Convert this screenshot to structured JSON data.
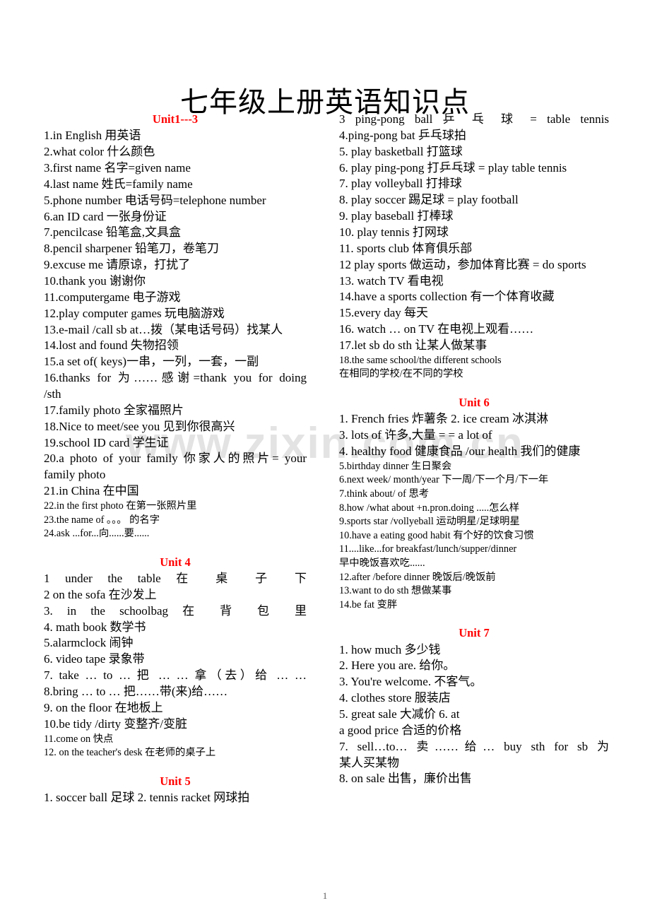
{
  "document": {
    "title": "七年级上册英语知识点",
    "page_number": "1",
    "watermark": "www.zixin.com.cn",
    "heading_color": "#ff0000"
  },
  "left_column": {
    "unit1_heading": "Unit1---3",
    "unit1_items": [
      "1.in English 用英语",
      "2.what color 什么颜色",
      "3.first name 名字=given name",
      "4.last name 姓氏=family name",
      "5.phone number 电话号码=telephone number",
      "6.an ID card 一张身份证",
      "7.pencilcase 铅笔盒,文具盒",
      "8.pencil sharpener 铅笔刀，卷笔刀",
      "9.excuse me 请原谅，打扰了",
      "10.thank you 谢谢你",
      "11.computergame 电子游戏",
      "12.play computer games 玩电脑游戏",
      "13.e-mail /call sb at…拨（某电话号码）找某人",
      "14.lost and found 失物招领",
      "15.a set of( keys)一串，一列，一套，一副",
      "16.thanks for 为……感谢=thank you for doing",
      "/sth",
      "17.family photo 全家福照片",
      "18.Nice to meet/see you 见到你很高兴",
      "19.school ID card 学生证",
      "20.a photo of your family 你家人的照片= your",
      "family photo",
      "21.in China  在中国"
    ],
    "unit1_items_small": [
      "22.in the first photo  在第一张照片里",
      "23.the name of  。。。 的名字",
      "24.ask ...for...向......要......"
    ],
    "unit4_heading": "Unit 4",
    "unit4_items": [
      "1  under   the   table        在   桌   子   下",
      "2  on the sofa    在沙发上",
      "3.   in    the    schoolbag    在   背   包   里",
      "4.  math book    数学书",
      "5.alarmclock  闹钟",
      "6. video tape    录象带",
      "7.  take  …   to  …   把 … … 拿（去）给 … …",
      "8.bring  …  to  …  把……带(来)给……",
      "9.  on the floor 在地板上",
      "10.be tidy /dirty  变整齐/变脏"
    ],
    "unit4_items_small": [
      "11.come on  快点",
      "12. on the teacher's desk  在老师的桌子上"
    ],
    "unit5_heading": "Unit 5",
    "unit5_items": [
      "1. soccer ball  足球    2. tennis racket    网球拍"
    ]
  },
  "right_column": {
    "unit5_cont_items": [
      "3   ping-pong  ball   乒 乓 球    =  table  tennis",
      "4.ping-pong bat  乒乓球拍",
      "5. play basketball    打篮球",
      "6. play ping-pong  打乒乓球  = play table tennis",
      "7. play volleyball    打排球",
      "8. play soccer    踢足球 = play football",
      "9.  play baseball    打棒球",
      "10. play tennis    打网球",
      "11.  sports club  体育俱乐部",
      "12 play sports 做运动，参加体育比赛  = do sports",
      "13.  watch TV   看电视",
      "14.have a  sports collection  有一个体育收藏",
      "15.every day     每天",
      "16.  watch  …  on TV    在电视上观看……",
      "17.let sb do sth  让某人做某事"
    ],
    "unit5_cont_items_small": [
      "18.the same school/the different schools",
      "在相同的学校/在不同的学校"
    ],
    "unit6_heading": "Unit 6",
    "unit6_items": [
      "1. French fries    炸薯条 2.   ice cream  冰淇淋",
      "3. lots of  许多,大量    = = a lot of",
      "4. healthy food 健康食品    /our health 我们的健康"
    ],
    "unit6_items_small": [
      "5.birthday dinner  生日聚会",
      "6.next week/ month/year 下一周/下一个月/下一年",
      "7.think about/ of  思考",
      "8.how /what about +n.pron.doing .....怎么样",
      "9.sports star /vollyeball   运动明星/足球明星",
      "10.have a eating good habit  有个好的饮食习惯",
      "11....like...for breakfast/lunch/supper/dinner",
      "早中晚饭喜欢吃......",
      "12.after /before dinner  晚饭后/晚饭前",
      "13.want to do sth   想做某事",
      "14.be fat 变胖"
    ],
    "unit7_heading": "Unit 7",
    "unit7_items": [
      "1. how much    多少钱",
      "2. Here you are.   给你。",
      "3. You're welcome.   不客气。",
      "4. clothes store  服装店",
      "5.  great sale  大减价                               6. at",
      "a good price 合适的价格",
      "7. sell…to…  卖……给…  buy     sth   for sb   为",
      "某人买某物",
      "8. on sale  出售，廉价出售"
    ]
  }
}
